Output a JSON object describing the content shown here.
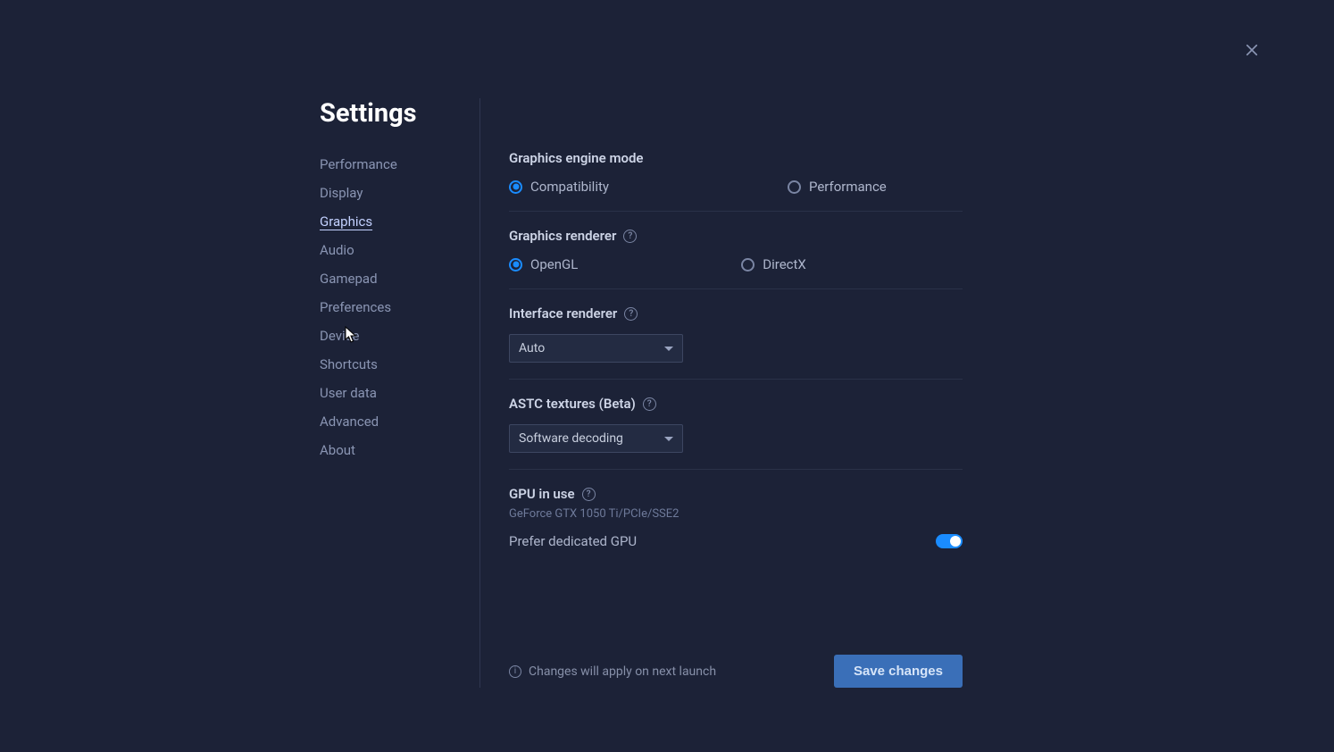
{
  "header": {
    "title": "Settings"
  },
  "sidebar": {
    "items": [
      {
        "label": "Performance",
        "active": false
      },
      {
        "label": "Display",
        "active": false
      },
      {
        "label": "Graphics",
        "active": true
      },
      {
        "label": "Audio",
        "active": false
      },
      {
        "label": "Gamepad",
        "active": false
      },
      {
        "label": "Preferences",
        "active": false
      },
      {
        "label": "Device",
        "active": false
      },
      {
        "label": "Shortcuts",
        "active": false
      },
      {
        "label": "User data",
        "active": false
      },
      {
        "label": "Advanced",
        "active": false
      },
      {
        "label": "About",
        "active": false
      }
    ]
  },
  "engine_mode": {
    "title": "Graphics engine mode",
    "options": [
      {
        "label": "Compatibility",
        "selected": true
      },
      {
        "label": "Performance",
        "selected": false
      }
    ]
  },
  "renderer": {
    "title": "Graphics renderer",
    "options": [
      {
        "label": "OpenGL",
        "selected": true
      },
      {
        "label": "DirectX",
        "selected": false
      }
    ]
  },
  "interface_renderer": {
    "title": "Interface renderer",
    "value": "Auto"
  },
  "astc": {
    "title": "ASTC textures (Beta)",
    "value": "Software decoding"
  },
  "gpu": {
    "title": "GPU in use",
    "name": "GeForce GTX 1050 Ti/PCIe/SSE2",
    "toggle_label": "Prefer dedicated GPU",
    "toggle_on": true
  },
  "footer": {
    "info": "Changes will apply on next launch",
    "save": "Save changes"
  }
}
